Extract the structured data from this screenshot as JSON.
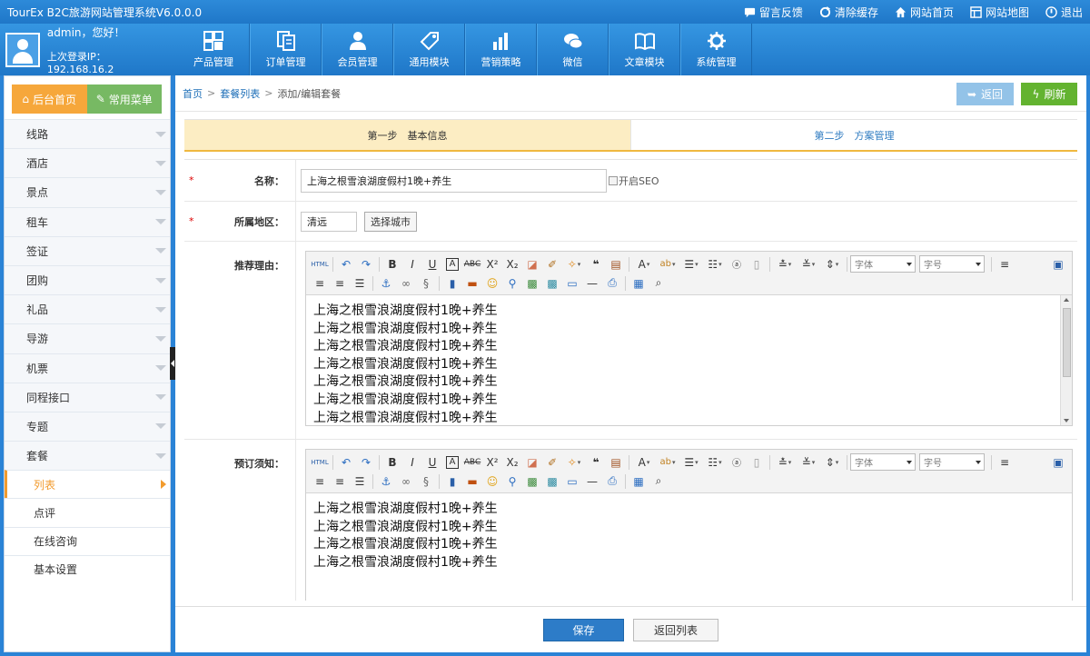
{
  "app_title": "TourEx B2C旅游网站管理系统V6.0.0.0",
  "top_links": [
    {
      "label": "留言反馈",
      "icon": "message-icon"
    },
    {
      "label": "清除缓存",
      "icon": "refresh-icon"
    },
    {
      "label": "网站首页",
      "icon": "home-icon"
    },
    {
      "label": "网站地图",
      "icon": "sitemap-icon"
    },
    {
      "label": "退出",
      "icon": "power-icon"
    }
  ],
  "user": {
    "greeting": "admin，您好！",
    "last_login": "上次登录IP：192.168.16.2"
  },
  "main_menu": [
    "产品管理",
    "订单管理",
    "会员管理",
    "通用模块",
    "营销策略",
    "微信",
    "文章模块",
    "系统管理"
  ],
  "sidebar": {
    "home_button": "后台首页",
    "common_button": "常用菜单",
    "items": [
      "线路",
      "酒店",
      "景点",
      "租车",
      "签证",
      "团购",
      "礼品",
      "导游",
      "机票",
      "同程接口",
      "专题",
      "套餐"
    ],
    "sub_items": [
      "列表",
      "点评",
      "在线咨询",
      "基本设置"
    ]
  },
  "breadcrumb": {
    "home": "首页",
    "list": "套餐列表",
    "current": "添加/编辑套餐"
  },
  "actions": {
    "back": "返回",
    "refresh": "刷新"
  },
  "steps": [
    "第一步　基本信息",
    "第二步　方案管理"
  ],
  "form": {
    "name_label": "名称：",
    "name_value": "上海之根雪浪湖度假村1晚+养生",
    "seo_label": "开启SEO",
    "region_label": "所属地区：",
    "region_value": "清远",
    "choose_city": "选择城市",
    "reason_label": "推荐理由：",
    "notice_label": "预订须知：",
    "font_placeholder": "字体",
    "size_placeholder": "字号",
    "reason_lines": [
      "上海之根雪浪湖度假村1晚+养生",
      "上海之根雪浪湖度假村1晚+养生",
      "上海之根雪浪湖度假村1晚+养生",
      "上海之根雪浪湖度假村1晚+养生",
      "上海之根雪浪湖度假村1晚+养生",
      "上海之根雪浪湖度假村1晚+养生",
      "上海之根雪浪湖度假村1晚+养生"
    ],
    "notice_lines": [
      "上海之根雪浪湖度假村1晚+养生",
      "上海之根雪浪湖度假村1晚+养生",
      "上海之根雪浪湖度假村1晚+养生",
      "上海之根雪浪湖度假村1晚+养生"
    ]
  },
  "footer": {
    "save": "保存",
    "back_list": "返回列表"
  }
}
